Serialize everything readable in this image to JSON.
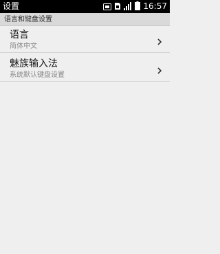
{
  "status_bar": {
    "title": "设置",
    "time": "16:57",
    "icons": [
      "screenshot-icon",
      "sim-icon",
      "signal-icon",
      "battery-icon"
    ]
  },
  "section": {
    "header": "语言和键盘设置"
  },
  "items": [
    {
      "title": "语言",
      "subtitle": "简体中文"
    },
    {
      "title": "魅族输入法",
      "subtitle": "系统默认键盘设置"
    }
  ],
  "colors": {
    "status_bar_bg": "#000000",
    "page_bg": "#efefef",
    "header_bg": "#d9d9d9",
    "subtitle_text": "#8a8a8a"
  }
}
